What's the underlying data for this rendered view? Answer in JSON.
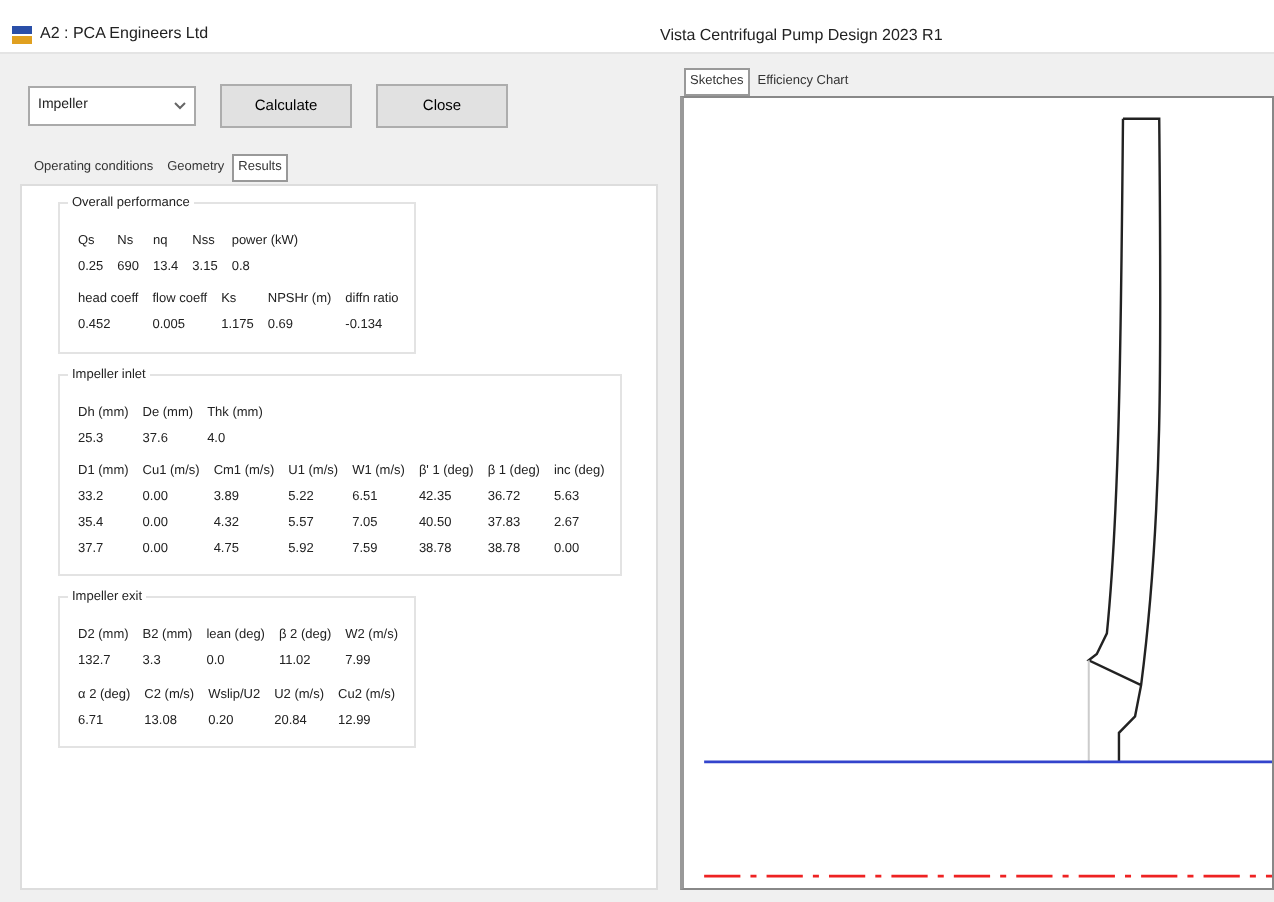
{
  "window": {
    "app": "A2 : PCA Engineers Ltd",
    "title": "Vista Centrifugal Pump Design 2023 R1"
  },
  "toolbar": {
    "dropdown": {
      "value": "Impeller"
    },
    "buttons": [
      "Calculate",
      "Close"
    ]
  },
  "tabs": [
    {
      "label": "Operating conditions",
      "selected": false
    },
    {
      "label": "Geometry",
      "selected": false
    },
    {
      "label": "Results",
      "selected": true
    }
  ],
  "groups": [
    {
      "title": "Overall performance",
      "blocks": [
        {
          "columns": [
            "Qs",
            "Ns",
            "nq",
            "Nss",
            "power (kW)"
          ],
          "rows": [
            [
              "0.25",
              "690",
              "13.4",
              "3.15",
              "0.8"
            ]
          ]
        },
        {
          "columns": [
            "head coeff",
            "flow coeff",
            "Ks",
            "NPSHr (m)",
            "diffn ratio"
          ],
          "rows": [
            [
              "0.452",
              "0.005",
              "1.175",
              "0.69",
              "-0.134"
            ]
          ]
        }
      ]
    },
    {
      "title": "Impeller inlet",
      "blocks": [
        {
          "columns": [
            "Dh (mm)",
            "De (mm)",
            "Thk (mm)"
          ],
          "rows": [
            [
              "25.3",
              "37.6",
              "4.0"
            ]
          ]
        },
        {
          "columns": [
            "D1 (mm)",
            "Cu1 (m/s)",
            "Cm1 (m/s)",
            "U1 (m/s)",
            "W1 (m/s)",
            "β' 1 (deg)",
            "β 1 (deg)",
            "inc (deg)"
          ],
          "rows": [
            [
              "33.2",
              "0.00",
              "3.89",
              "5.22",
              "6.51",
              "42.35",
              "36.72",
              "5.63"
            ],
            [
              "35.4",
              "0.00",
              "4.32",
              "5.57",
              "7.05",
              "40.50",
              "37.83",
              "2.67"
            ],
            [
              "37.7",
              "0.00",
              "4.75",
              "5.92",
              "7.59",
              "38.78",
              "38.78",
              "0.00"
            ]
          ]
        }
      ]
    },
    {
      "title": "Impeller exit",
      "blocks": [
        {
          "columns": [
            "D2 (mm)",
            "B2 (mm)",
            "lean (deg)",
            "β 2 (deg)",
            "W2 (m/s)"
          ],
          "rows": [
            [
              "132.7",
              "3.3",
              "0.0",
              "11.02",
              "7.99"
            ]
          ]
        },
        {
          "columns": [
            "α 2 (deg)",
            "C2 (m/s)",
            "Wslip/U2",
            "U2 (m/s)",
            "Cu2 (m/s)"
          ],
          "rows": [
            [
              "6.71",
              "13.08",
              "0.20",
              "20.84",
              "12.99"
            ]
          ]
        }
      ]
    }
  ],
  "right_tabs": [
    {
      "label": "Sketches",
      "selected": true
    },
    {
      "label": "Efficiency Chart",
      "selected": false
    }
  ]
}
